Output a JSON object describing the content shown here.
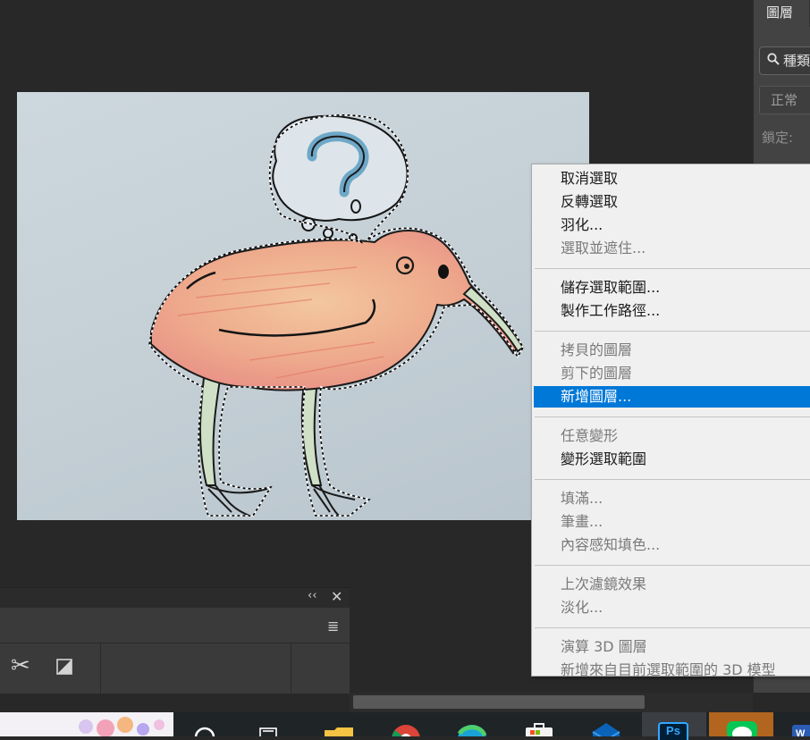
{
  "layers_panel": {
    "tab_label": "圖層",
    "search_text": "種類",
    "blend_mode": "正常",
    "lock_label": "鎖定:"
  },
  "context_menu": {
    "selected": "新增圖層...",
    "groups": [
      [
        {
          "label": "取消選取",
          "enabled": true
        },
        {
          "label": "反轉選取",
          "enabled": true
        },
        {
          "label": "羽化...",
          "enabled": true
        },
        {
          "label": "選取並遮住...",
          "enabled": false
        }
      ],
      [
        {
          "label": "儲存選取範圍...",
          "enabled": true
        },
        {
          "label": "製作工作路徑...",
          "enabled": true
        }
      ],
      [
        {
          "label": "拷貝的圖層",
          "enabled": false
        },
        {
          "label": "剪下的圖層",
          "enabled": false
        },
        {
          "label": "新增圖層...",
          "enabled": true
        }
      ],
      [
        {
          "label": "任意變形",
          "enabled": false
        },
        {
          "label": "變形選取範圍",
          "enabled": true
        }
      ],
      [
        {
          "label": "填滿...",
          "enabled": false
        },
        {
          "label": "筆畫...",
          "enabled": false
        },
        {
          "label": "內容感知填色...",
          "enabled": false
        }
      ],
      [
        {
          "label": "上次濾鏡效果",
          "enabled": false
        },
        {
          "label": "淡化...",
          "enabled": false
        }
      ],
      [
        {
          "label": "演算 3D 圖層",
          "enabled": false
        },
        {
          "label": "新增來自目前選取範圍的 3D 模型",
          "enabled": false
        }
      ]
    ]
  },
  "bottom_panel": {
    "collapse_icon": "double-chevron-left-icon",
    "close_icon": "close-icon",
    "menu_icon": "hamburger-menu-icon",
    "tool_icons": [
      "scissors-icon",
      "mask-icon"
    ]
  },
  "taskbar": {
    "apps": [
      "widgets",
      "search",
      "task-view",
      "file-explorer",
      "chrome",
      "edge",
      "store",
      "mail",
      "photoshop",
      "line",
      "word"
    ],
    "photoshop_label": "Ps"
  },
  "colors": {
    "workspace": "#282828",
    "menu_bg": "#f0f0f0",
    "menu_highlight": "#0078d7",
    "panel": "#434343"
  }
}
